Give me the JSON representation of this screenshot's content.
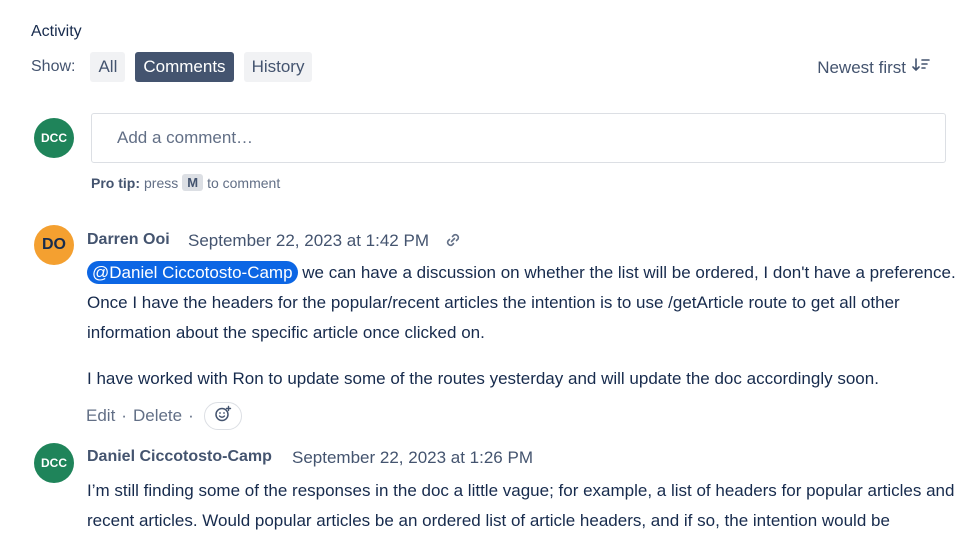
{
  "activity": {
    "heading": "Activity",
    "show_label": "Show:",
    "filters": [
      "All",
      "Comments",
      "History"
    ],
    "active_filter": "Comments",
    "sort_label": "Newest first"
  },
  "composer": {
    "avatar_initials": "DCC",
    "placeholder": "Add a comment…",
    "pro_tip_bold": "Pro tip:",
    "pro_tip_press": "press",
    "pro_tip_key": "M",
    "pro_tip_suffix": "to comment"
  },
  "comments": [
    {
      "avatar_initials": "DO",
      "author": "Darren Ooi",
      "timestamp": "September 22, 2023 at 1:42 PM",
      "mention": "@Daniel Ciccotosto-Camp",
      "paragraph1_rest": " we can have a discussion on whether the list will be ordered, I don't have a preference. Once I have the headers for the popular/recent articles the intention is to use /getArticle route to get all other information about the specific article once clicked on.",
      "paragraph2": "I have worked with Ron to update some of the routes yesterday and will update the doc accordingly soon.",
      "actions": {
        "edit": "Edit",
        "delete": "Delete",
        "sep": "·"
      }
    },
    {
      "avatar_initials": "DCC",
      "author": "Daniel Ciccotosto-Camp",
      "timestamp": "September 22, 2023 at 1:26 PM",
      "paragraph1": "I’m still finding some of the responses in the doc a little vague; for example, a list of headers for popular articles and recent articles. Would popular articles be an ordered list of article headers, and if so, the intention would be"
    }
  ],
  "colors": {
    "text": "#172b4d",
    "subtle": "#44546f",
    "active_pill": "#44546f",
    "mention": "#0c66e4",
    "avatar_green": "#1f845a",
    "avatar_orange": "#f4a030"
  },
  "icons": {
    "sort": "sort-descending-icon",
    "link": "link-icon",
    "reaction": "add-reaction-icon"
  }
}
